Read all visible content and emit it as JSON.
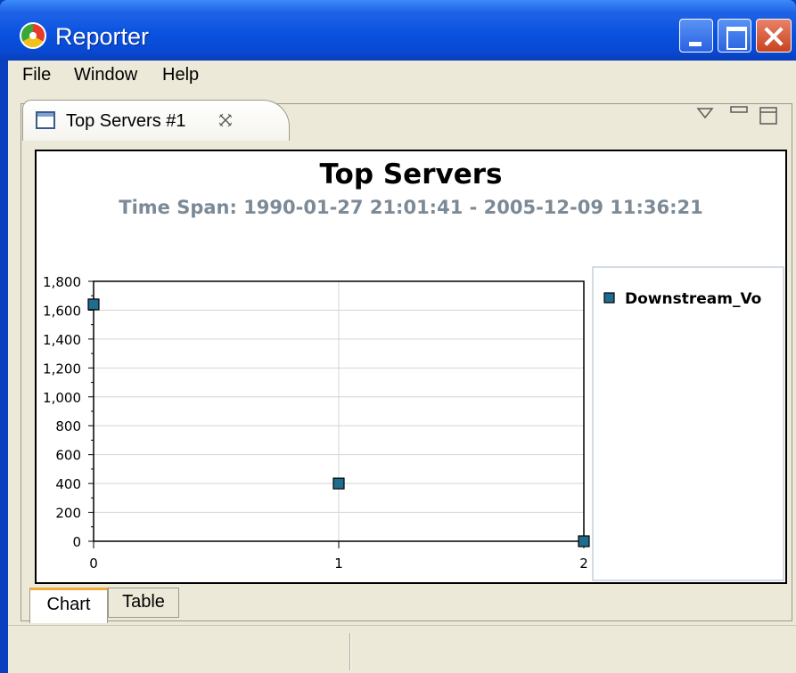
{
  "window": {
    "title": "Reporter",
    "colors": {
      "titlebar": "#0a52e0",
      "close": "#c8431f"
    }
  },
  "menu": {
    "items": [
      "File",
      "Window",
      "Help"
    ]
  },
  "view": {
    "tab_label": "Top Servers #1"
  },
  "bottom_tabs": [
    "Chart",
    "Table"
  ],
  "chart_data": {
    "type": "scatter",
    "title": "Top Servers",
    "subtitle": "Time Span: 1990-01-27 21:01:41 - 2005-12-09 11:36:21",
    "x": [
      0,
      1,
      2
    ],
    "xticks": [
      "0",
      "1",
      "2"
    ],
    "yticks": [
      "1,800",
      "1,600",
      "1,400",
      "1,200",
      "1,000",
      "800",
      "600",
      "400",
      "200",
      "0"
    ],
    "ylim": [
      0,
      1800
    ],
    "xlim": [
      0,
      2
    ],
    "grid": true,
    "legend_position": "right",
    "series": [
      {
        "name": "Downstream_Vo",
        "values": [
          1640,
          400,
          0
        ],
        "color": "#1f6c8f"
      }
    ]
  }
}
